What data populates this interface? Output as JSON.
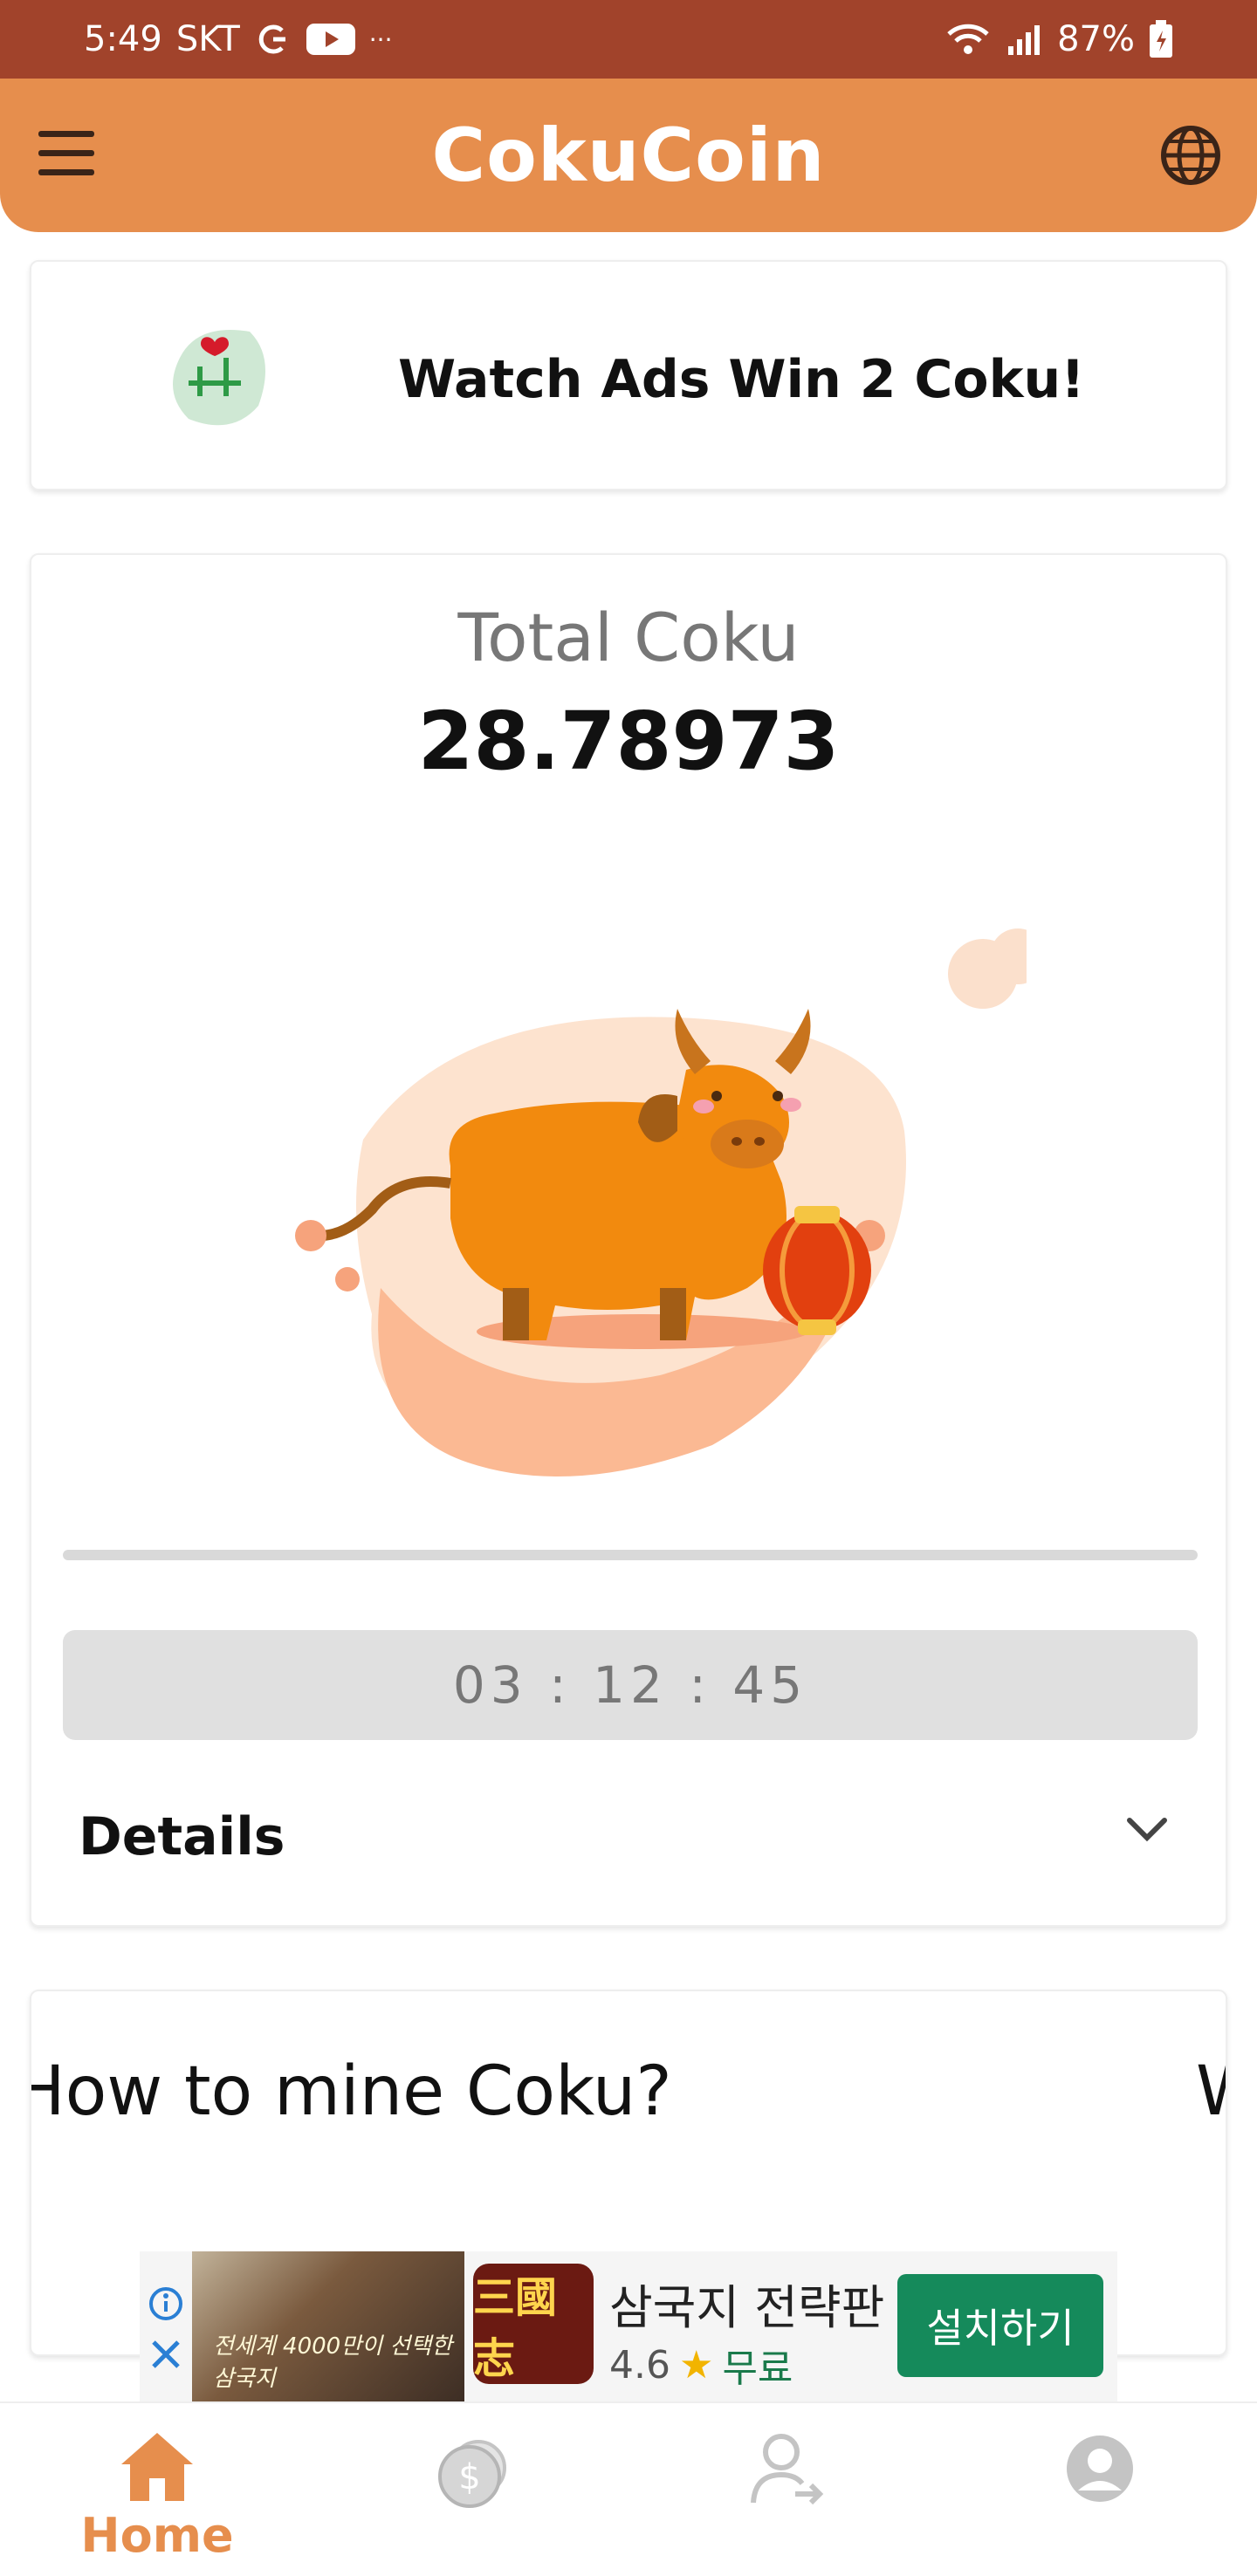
{
  "status_bar": {
    "time": "5:49",
    "carrier": "SKT",
    "battery": "87%"
  },
  "app_bar": {
    "title": "CokuCoin"
  },
  "ads_card": {
    "label": "Watch Ads Win 2 Coku!"
  },
  "mining_card": {
    "total_label": "Total Coku",
    "total_value": "28.78973",
    "progress": 0,
    "timer": "03 : 12 : 45",
    "details_label": "Details"
  },
  "how_card": {
    "title": "How to mine Coku?",
    "peek": "W"
  },
  "ad_banner": {
    "title": "삼국지 전략판",
    "rating": "4.6",
    "price": "무료",
    "install_label": "설치하기",
    "logo_text": "三國志",
    "image_caption": "전세계 4000만이 선택한 삼국지"
  },
  "bottom_nav": {
    "items": [
      {
        "label": "Home",
        "icon": "home-icon",
        "active": true
      },
      {
        "label": "",
        "icon": "coins-icon",
        "active": false
      },
      {
        "label": "",
        "icon": "invite-user-icon",
        "active": false
      },
      {
        "label": "",
        "icon": "profile-icon",
        "active": false
      }
    ]
  },
  "colors": {
    "status_bar": "#A1432B",
    "app_bar": "#E68E4D",
    "accent": "#E68E4D",
    "install_button": "#158a5b"
  }
}
